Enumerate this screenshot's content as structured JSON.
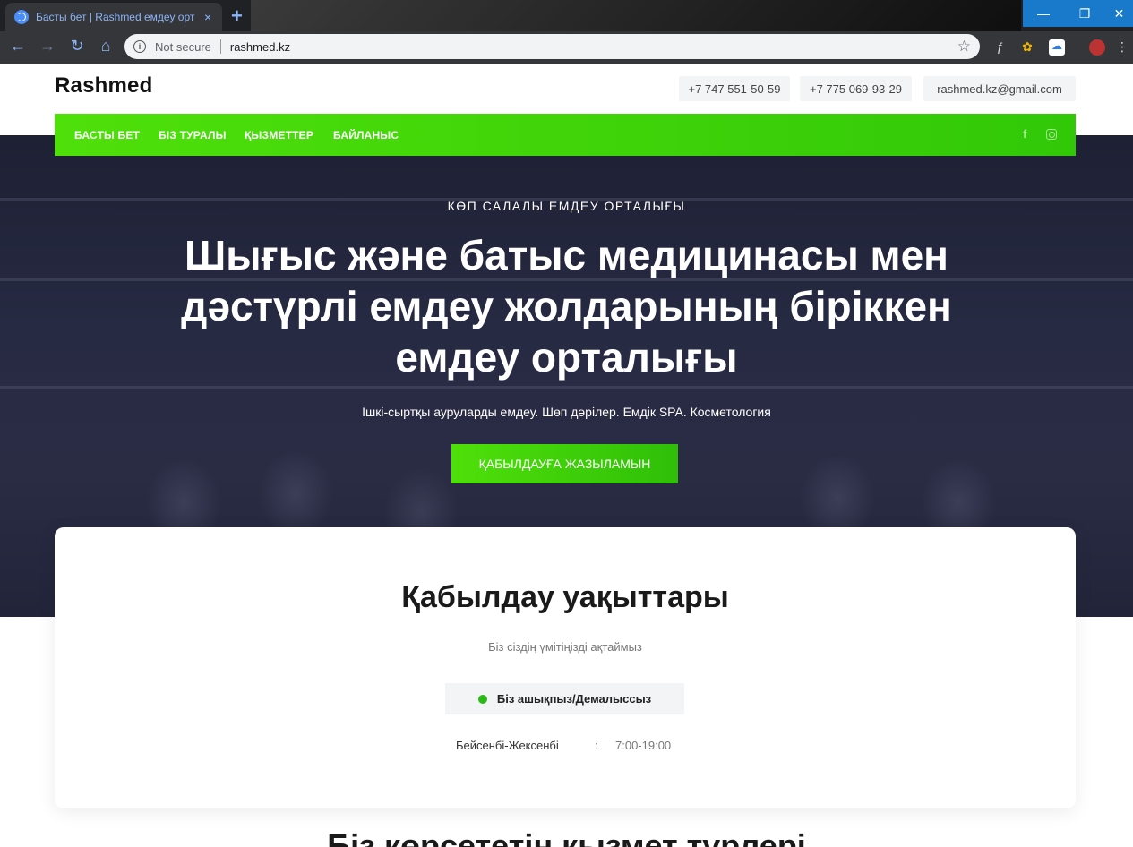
{
  "browser": {
    "tab_title": "Басты бет | Rashmed емдеу орт",
    "tab_close": "×",
    "new_tab": "+",
    "security_label": "Not secure",
    "url": "rashmed.kz",
    "window_min": "—",
    "window_max": "❐",
    "window_close": "✕"
  },
  "header": {
    "logo": "Rashmed",
    "phone1": "+7 747 551-50-59",
    "phone2": "+7 775 069-93-29",
    "email": "rashmed.kz@gmail.com"
  },
  "nav": {
    "items": [
      "БАСТЫ БЕТ",
      "БІЗ ТУРАЛЫ",
      "ҚЫЗМЕТТЕР",
      "БАЙЛАНЫС"
    ],
    "facebook": "f"
  },
  "hero": {
    "eyebrow": "КӨП САЛАЛЫ ЕМДЕУ ОРТАЛЫҒЫ",
    "headline": "Шығыс және батыс медицинасы мен дәстүрлі емдеу жолдарының біріккен емдеу орталығы",
    "subline": "Ішкі-сыртқы ауруларды емдеу. Шөп дәрілер. Емдік SPA. Косметология",
    "cta": "ҚАБЫЛДАУҒА ЖАЗЫЛАМЫН"
  },
  "hours": {
    "title": "Қабылдау уақыттары",
    "subtitle": "Біз сіздің үмітіңізді ақтаймыз",
    "status": "Біз ашықпыз/Демалыссыз",
    "status_color": "#2db81a",
    "day": "Бейсенбі-Жексенбі",
    "separator": ":",
    "time": "7:00-19:00"
  },
  "services": {
    "title": "Біз көрсететін қызмет түрлері"
  },
  "colors": {
    "accent_green": "#3fd60a",
    "hero_bg": "#25283f",
    "browser_dark": "#202124"
  }
}
